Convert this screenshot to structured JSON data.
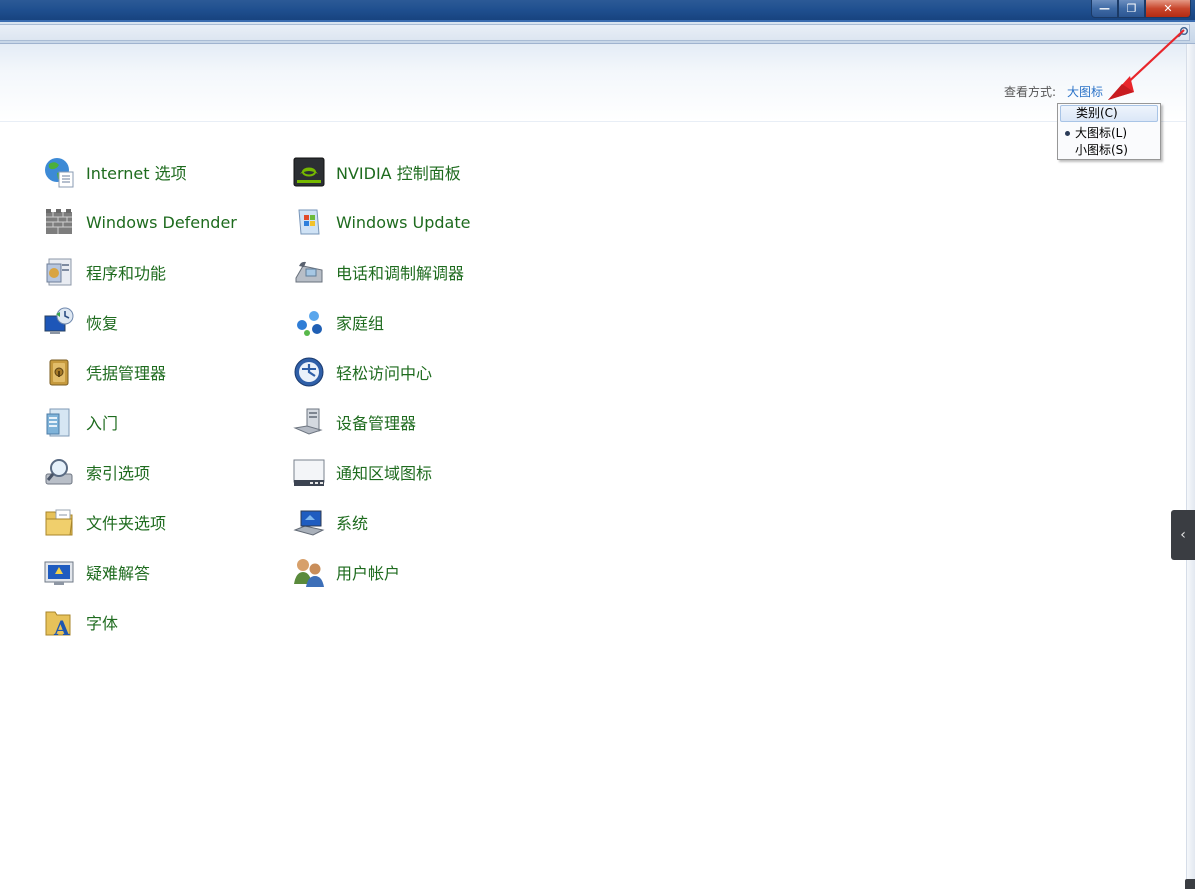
{
  "window": {
    "minimize_glyph": "—",
    "restore_glyph": "❐",
    "close_glyph": "✕"
  },
  "header": {
    "view_by_label": "查看方式:",
    "view_by_value": "大图标"
  },
  "view_menu": {
    "items": [
      {
        "label": "类别(C)",
        "selected": false,
        "hover": true
      },
      {
        "label": "大图标(L)",
        "selected": true,
        "hover": false
      },
      {
        "label": "小图标(S)",
        "selected": false,
        "hover": false
      }
    ]
  },
  "items": {
    "col1": [
      {
        "label": "Internet 选项",
        "icon": "internet-globe-icon"
      },
      {
        "label": "Windows Defender",
        "icon": "defender-wall-icon"
      },
      {
        "label": "程序和功能",
        "icon": "programs-features-icon"
      },
      {
        "label": "恢复",
        "icon": "recovery-icon"
      },
      {
        "label": "凭据管理器",
        "icon": "credential-vault-icon"
      },
      {
        "label": "入门",
        "icon": "getting-started-icon"
      },
      {
        "label": "索引选项",
        "icon": "indexing-magnifier-icon"
      },
      {
        "label": "文件夹选项",
        "icon": "folder-options-icon"
      },
      {
        "label": "疑难解答",
        "icon": "troubleshooting-icon"
      },
      {
        "label": "字体",
        "icon": "fonts-icon"
      }
    ],
    "col2": [
      {
        "label": "NVIDIA 控制面板",
        "icon": "nvidia-icon"
      },
      {
        "label": "Windows Update",
        "icon": "windows-update-icon"
      },
      {
        "label": "电话和调制解调器",
        "icon": "phone-modem-icon"
      },
      {
        "label": "家庭组",
        "icon": "homegroup-icon"
      },
      {
        "label": "轻松访问中心",
        "icon": "ease-of-access-icon"
      },
      {
        "label": "设备管理器",
        "icon": "device-manager-icon"
      },
      {
        "label": "通知区域图标",
        "icon": "notification-area-icon"
      },
      {
        "label": "系统",
        "icon": "system-icon"
      },
      {
        "label": "用户帐户",
        "icon": "user-accounts-icon"
      }
    ]
  },
  "side_tab": {
    "glyph": "‹"
  },
  "colors": {
    "link_green": "#1e6b1e",
    "link_blue": "#2b73c8",
    "title_blue": "#1f4f8f",
    "annotation_red": "#e8262b"
  }
}
